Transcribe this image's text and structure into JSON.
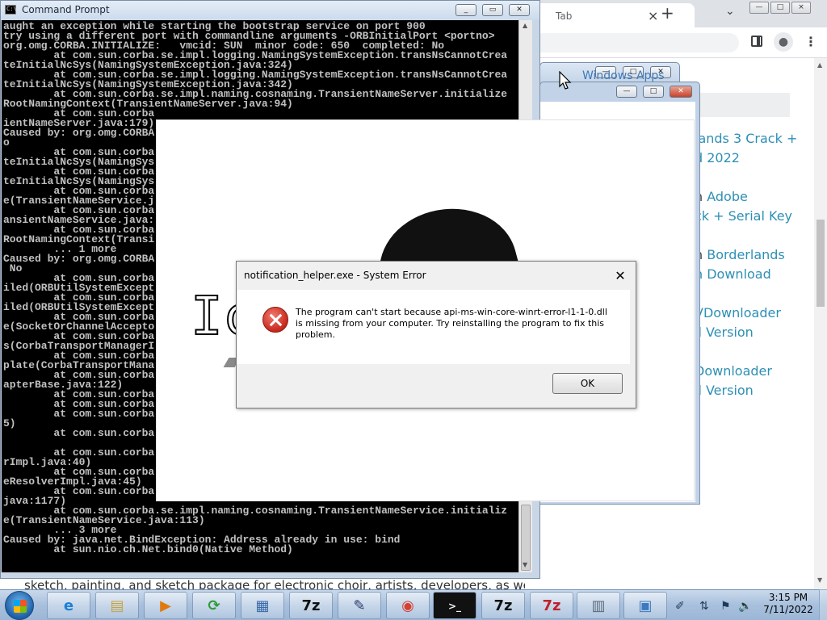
{
  "browser": {
    "tab_title": "Tab",
    "tab_close": "×",
    "new_tab": "+",
    "tab_search": "⌄",
    "minimize": "—",
    "maximize": "□",
    "close": "×",
    "menu": "⋮",
    "profile": "●",
    "links": [
      {
        "pre": "",
        "link": "lands 3 Crack +"
      },
      {
        "pre": "",
        "link": "d 2022"
      },
      {
        "pre": "n ",
        "link": "Adobe"
      },
      {
        "pre": "",
        "link": "ck + Serial Key"
      },
      {
        "pre": "n ",
        "link": "Borderlands"
      },
      {
        "pre": "",
        "link": "n Download"
      },
      {
        "pre": "",
        "link": "VDownloader"
      },
      {
        "pre": "",
        "link": "ll Version"
      },
      {
        "pre": "",
        "link": "Downloader"
      },
      {
        "pre": "",
        "link": "ll Version"
      }
    ],
    "behind_title_fragment": "Windows Apps"
  },
  "cmd": {
    "title": "Command Prompt",
    "minimize": "_",
    "maximize": "▭",
    "close": "✕",
    "icon_text": "C:\\",
    "lines": [
      "aught an exception while starting the bootstrap service on port 900",
      "try using a different port with commandline arguments -ORBInitialPort <portno>",
      "org.omg.CORBA.INITIALIZE:   vmcid: SUN  minor code: 650  completed: No",
      "        at com.sun.corba.se.impl.logging.NamingSystemException.transNsCannotCrea",
      "teInitialNcSys(NamingSystemException.java:324)",
      "        at com.sun.corba.se.impl.logging.NamingSystemException.transNsCannotCrea",
      "teInitialNcSys(NamingSystemException.java:342)",
      "        at com.sun.corba.se.impl.naming.cosnaming.TransientNameServer.initialize",
      "RootNamingContext(TransientNameServer.java:94)",
      "        at com.sun.corba",
      "ientNameServer.java:179)",
      "Caused by: org.omg.CORBA",
      "o",
      "        at com.sun.corba",
      "teInitialNcSys(NamingSys",
      "        at com.sun.corba",
      "teInitialNcSys(NamingSys",
      "        at com.sun.corba",
      "e(TransientNameService.j",
      "        at com.sun.corba",
      "ansientNameService.java:",
      "        at com.sun.corba",
      "RootNamingContext(Transi",
      "        ... 1 more",
      "Caused by: org.omg.CORBA",
      " No",
      "        at com.sun.corba",
      "iled(ORBUtilSystemExcept",
      "        at com.sun.corba",
      "iled(ORBUtilSystemExcept",
      "        at com.sun.corba",
      "e(SocketOrChannelAccepto",
      "        at com.sun.corba",
      "s(CorbaTransportManagerI",
      "        at com.sun.corba",
      "plate(CorbaTransportMana",
      "        at com.sun.corba",
      "apterBase.java:122)",
      "        at com.sun.corba",
      "        at com.sun.corba",
      "        at com.sun.corba",
      "5)",
      "        at com.sun.corba",
      "",
      "        at com.sun.corba",
      "rImpl.java:40)",
      "        at com.sun.corba",
      "eResolverImpl.java:45)",
      "        at com.sun.corba",
      "java:1177)",
      "        at com.sun.corba.se.impl.naming.cosnaming.TransientNameService.initializ",
      "e(TransientNameService.java:113)",
      "        ... 3 more",
      "Caused by: java.net.BindException: Address already in use: bind",
      "        at sun.nio.ch.Net.bind0(Native Method)"
    ],
    "scroll_up": "▲",
    "scroll_down": "▼"
  },
  "app_window": {
    "outline_text": "Ic"
  },
  "dialog": {
    "title": "notification_helper.exe - System Error",
    "close": "✕",
    "message": "The program can't start because api-ms-win-core-winrt-error-l1-1-0.dll is missing from your computer. Try reinstalling the program to fix this problem.",
    "ok_label": "OK"
  },
  "behind_text": "sketch, painting, and sketch package for electronic choir, artists, developers, as well as",
  "helper_windows": {
    "minimize": "—",
    "maximize": "□",
    "close": "✕"
  },
  "taskbar": {
    "items": [
      {
        "name": "ie",
        "glyph": "e",
        "color": "#1b7fd6"
      },
      {
        "name": "explorer",
        "glyph": "▤",
        "color": "#c9a23a"
      },
      {
        "name": "media-player",
        "glyph": "▶",
        "color": "#e07a10"
      },
      {
        "name": "sync",
        "glyph": "⟳",
        "color": "#2f9a3a"
      },
      {
        "name": "control-panel",
        "glyph": "▦",
        "color": "#3a6aa8"
      },
      {
        "name": "7zip",
        "glyph": "7z",
        "color": "#111111"
      },
      {
        "name": "editor",
        "glyph": "✎",
        "color": "#2a3a6a"
      },
      {
        "name": "chrome",
        "glyph": "◉",
        "color": "#d64030"
      },
      {
        "name": "cmd",
        "glyph": ">_",
        "color": "#f0f0f0"
      },
      {
        "name": "7zip-2",
        "glyph": "7z",
        "color": "#111111"
      },
      {
        "name": "7zip-error",
        "glyph": "7z",
        "color": "#c0202a"
      },
      {
        "name": "notepad",
        "glyph": "▥",
        "color": "#5a6a7a"
      },
      {
        "name": "window-app",
        "glyph": "▣",
        "color": "#3a7abf"
      }
    ],
    "clock_time": "3:15 PM",
    "clock_date": "7/11/2022",
    "tray": [
      "✐",
      "⇅",
      "⚑",
      "🔈"
    ]
  }
}
